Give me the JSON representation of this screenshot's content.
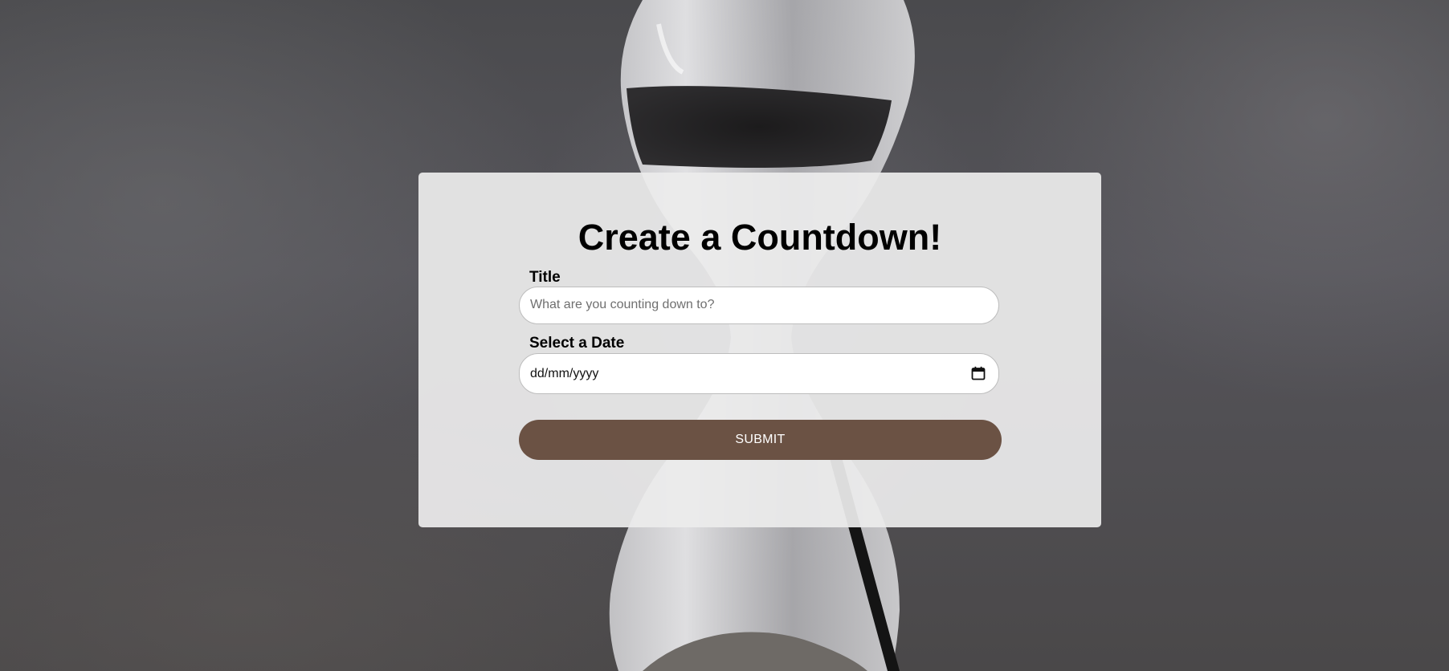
{
  "form": {
    "heading": "Create a Countdown!",
    "title_label": "Title",
    "title_placeholder": "What are you counting down to?",
    "date_label": "Select a Date",
    "date_placeholder": "dd/mm/yyyy",
    "submit_label": "SUBMIT"
  },
  "colors": {
    "submit_button": "#6b5244",
    "card_background": "#ececec"
  },
  "icons": {
    "date_picker": "calendar-icon"
  }
}
